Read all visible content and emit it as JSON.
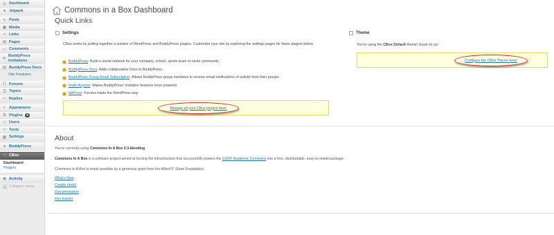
{
  "sidebar": {
    "items": [
      {
        "id": "dashboard",
        "label": "Dashboard",
        "icon": "dashboard-icon"
      },
      {
        "id": "jetpack",
        "label": "Jetpack",
        "icon": "jetpack-icon"
      },
      {
        "id": "posts",
        "label": "Posts",
        "icon": "posts-icon"
      },
      {
        "id": "media",
        "label": "Media",
        "icon": "media-icon"
      },
      {
        "id": "links",
        "label": "Links",
        "icon": "links-icon"
      },
      {
        "id": "pages",
        "label": "Pages",
        "icon": "pages-icon"
      },
      {
        "id": "comments",
        "label": "Comments",
        "icon": "comments-icon"
      },
      {
        "id": "bp-invitations",
        "label": "BuddyPress Invitations",
        "icon": "invitations-icon"
      },
      {
        "id": "bp-docs",
        "label": "BuddyPress Docs",
        "icon": "docs-icon"
      },
      {
        "id": "site-features",
        "label": "Site Features",
        "icon": ""
      },
      {
        "id": "forums",
        "label": "Forums",
        "icon": "forums-icon"
      },
      {
        "id": "topics",
        "label": "Topics",
        "icon": "topics-icon"
      },
      {
        "id": "replies",
        "label": "Replies",
        "icon": "replies-icon"
      },
      {
        "id": "appearance",
        "label": "Appearance",
        "icon": "appearance-icon"
      },
      {
        "id": "plugins",
        "label": "Plugins",
        "icon": "plugins-icon",
        "badge": "6"
      },
      {
        "id": "users",
        "label": "Users",
        "icon": "users-icon"
      },
      {
        "id": "tools",
        "label": "Tools",
        "icon": "tools-icon"
      },
      {
        "id": "settings",
        "label": "Settings",
        "icon": "settings-icon"
      },
      {
        "id": "buddypress",
        "label": "BuddyPress",
        "icon": "buddypress-icon"
      },
      {
        "id": "cbox",
        "label": "CBox",
        "icon": "cbox-icon"
      }
    ],
    "cbox_submenu": [
      "Dashboard",
      "Plugins"
    ],
    "activity_label": "Activity",
    "collapse_label": "Collapse menu"
  },
  "header": {
    "title": "Commons in a Box Dashboard"
  },
  "quick_links": {
    "title": "Quick Links",
    "settings": {
      "title": "Settings",
      "intro": "CBox works by pulling together a number of WordPress and BuddyPress plugins. Customize your site by exploring the settings pages for these plugins below.",
      "plugins": [
        {
          "name": "BuddyPress",
          "desc": " - Build a social network for your company, school, sports team or niche community."
        },
        {
          "name": "BuddyPress Docs",
          "desc": " - Adds collaborative Docs to BuddyPress."
        },
        {
          "name": "BuddyPress Group Email Subscription",
          "desc": " - Allows BuddyPress group members to receive email notifications of activity from their groups."
        },
        {
          "name": "Invite Anyone",
          "desc": " - Makes BuddyPress' invitation features more powerful."
        },
        {
          "name": "bbPress",
          "desc": " - Forums made the WordPress way."
        }
      ],
      "manage_link": "Manage all your CBox plugins here!"
    },
    "theme": {
      "title": "Theme",
      "text_before": "You're using the ",
      "theme_name": "CBox Default",
      "text_after": " theme! Good on ya!",
      "configure_link": "Configure the CBox Theme here!"
    }
  },
  "about": {
    "title": "About",
    "version_before": "You're currently using ",
    "version_name": "Commons In A Box 0.3-bleeding",
    "desc_strong": "Commons In A Box",
    "desc_mid": " is a software project aimed at turning the infrastructure that successfully powers the ",
    "desc_link": "CUNY Academic Commons",
    "desc_end": " into a free, distributable, easy-to-install package.",
    "grant": "Commons In A Box is made possible by a generous grant from the Alfred P. Sloan Foundation.",
    "links": [
      "What's New",
      "Credits (todo)",
      "Documentation",
      "Dev tracker"
    ]
  },
  "colors": {
    "link": "#21759b",
    "highlight_border": "#c22233",
    "notice_bg": "#ffffe0"
  }
}
